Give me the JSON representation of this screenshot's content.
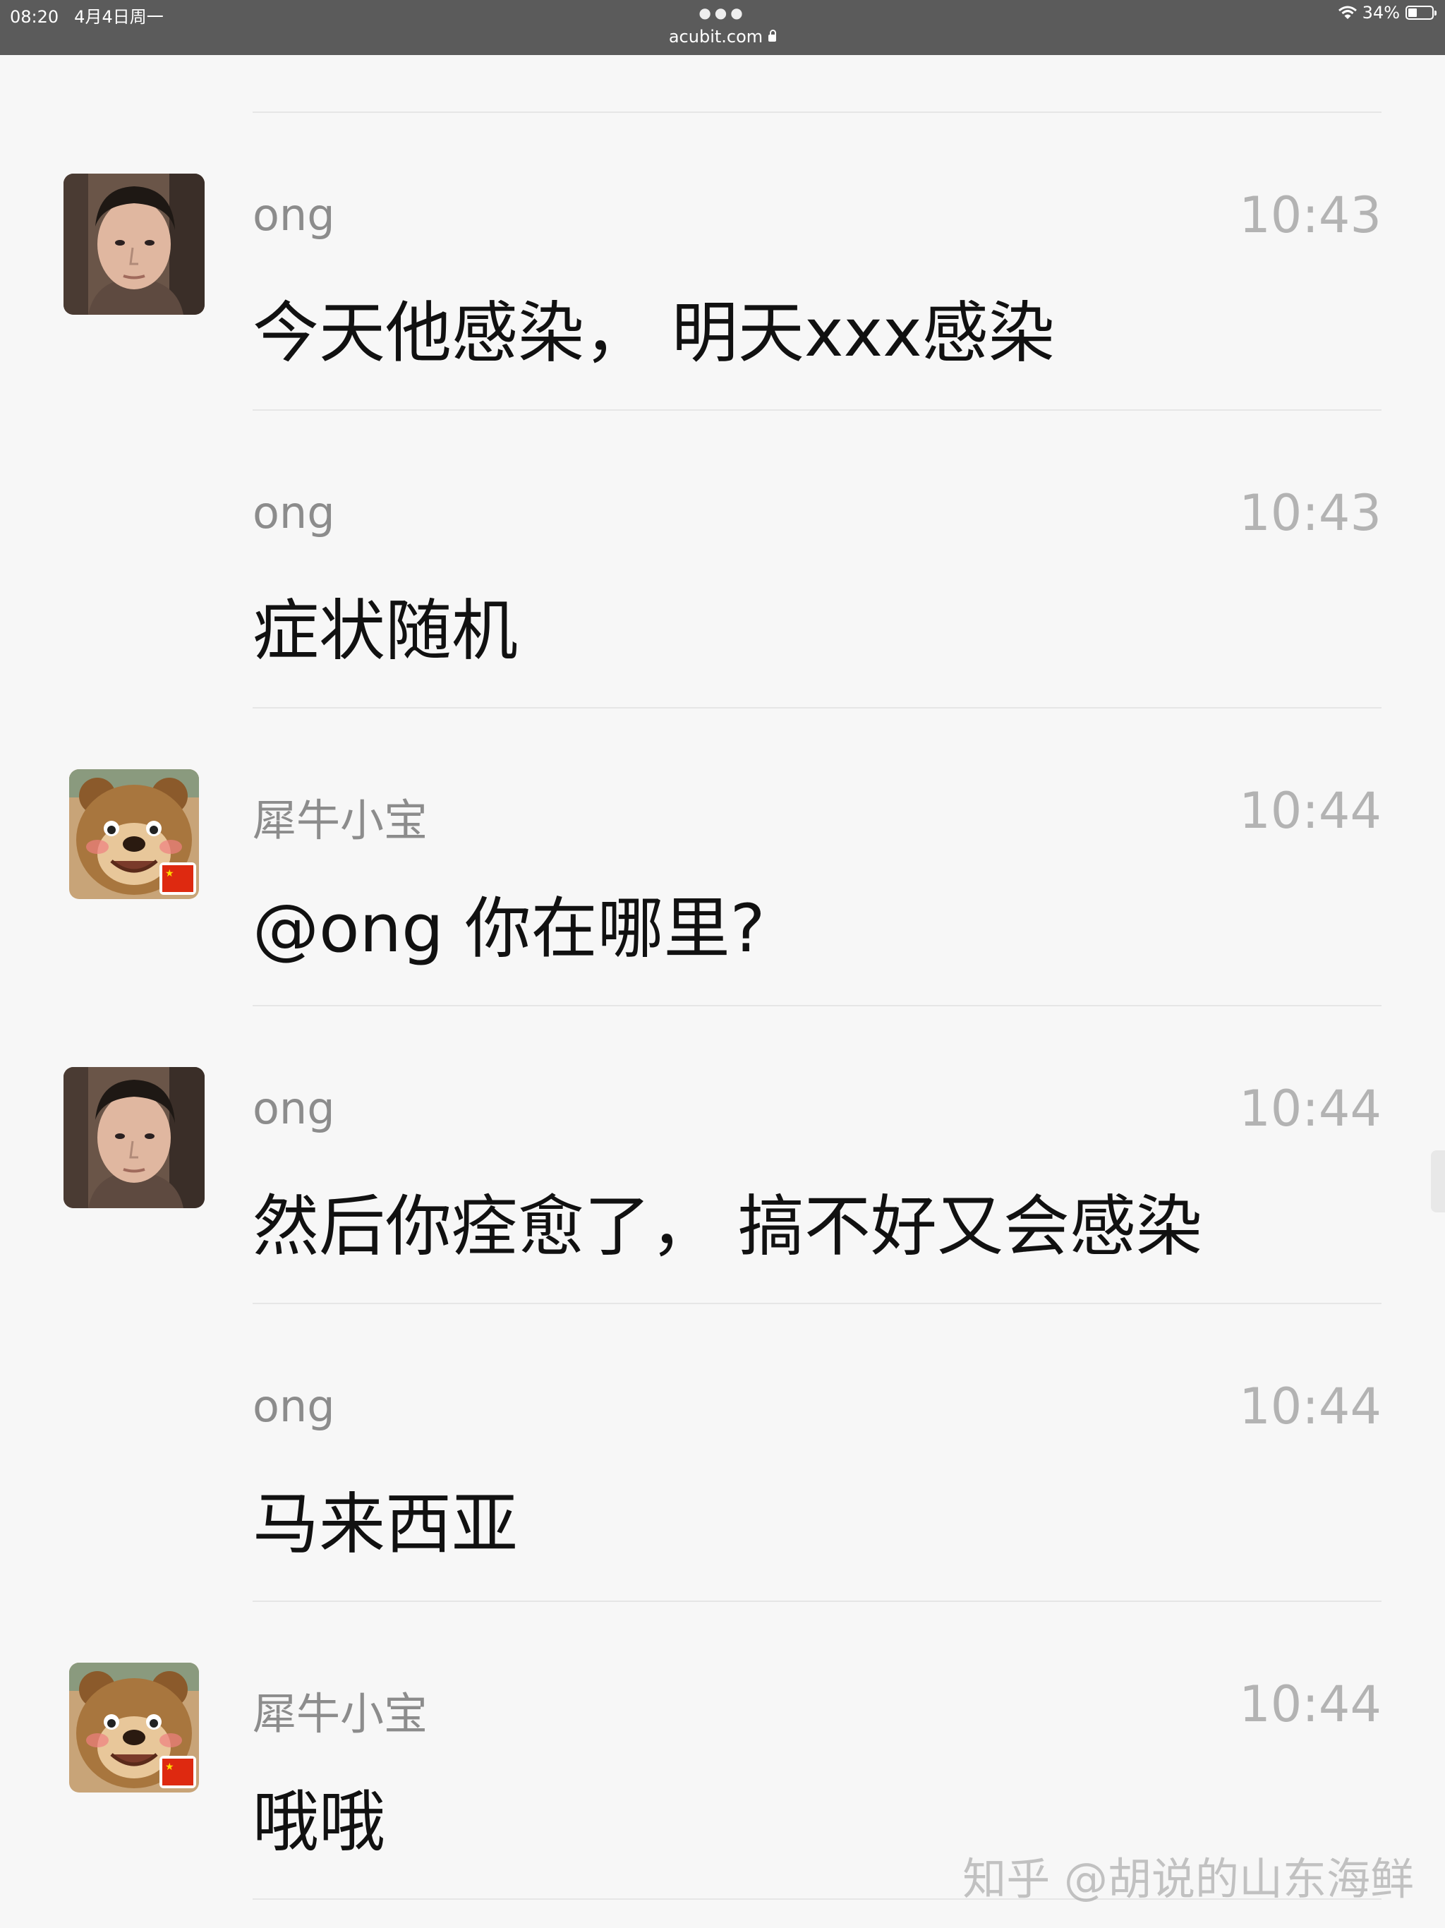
{
  "status_bar": {
    "time": "08:20",
    "date": "4月4日周一",
    "url": "acubit.com",
    "battery": "34%",
    "battery_level": 0.34
  },
  "messages": [
    {
      "name": "ong",
      "time": "10:43",
      "text": "今天他感染， 明天xxx感染",
      "avatar": "man-photo"
    },
    {
      "name": "ong",
      "time": "10:43",
      "text": "症状随机",
      "avatar": null
    },
    {
      "name": "犀牛小宝",
      "time": "10:44",
      "text": "@ong 你在哪里?",
      "avatar": "bear-cartoon"
    },
    {
      "name": "ong",
      "time": "10:44",
      "text": "然后你痊愈了， 搞不好又会感染",
      "avatar": "man-photo"
    },
    {
      "name": "ong",
      "time": "10:44",
      "text": "马来西亚",
      "avatar": null
    },
    {
      "name": "犀牛小宝",
      "time": "10:44",
      "text": "哦哦",
      "avatar": "bear-cartoon"
    }
  ],
  "watermark": "知乎 @胡说的山东海鲜",
  "colors": {
    "status_bar": "#5b5b5b",
    "background": "#f7f7f7",
    "name": "#8c8c8c",
    "time": "#b3b3b3",
    "text": "#111111",
    "separator": "#e6e6e6"
  }
}
